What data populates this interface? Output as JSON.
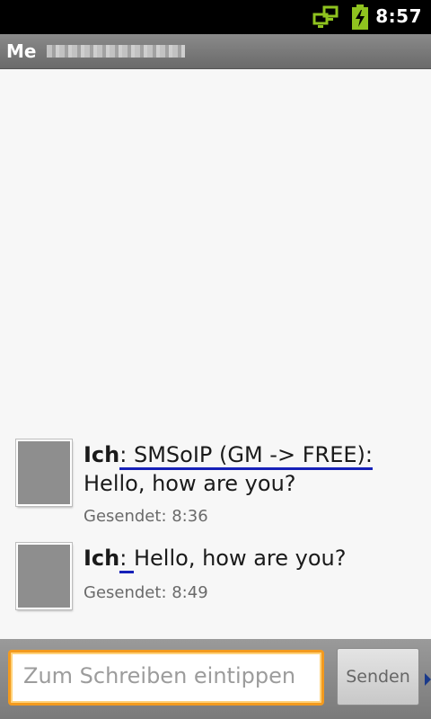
{
  "status_bar": {
    "time": "8:57",
    "icons": [
      "network-sync-icon",
      "battery-charging-icon"
    ]
  },
  "header": {
    "contact_label": "Me"
  },
  "messages": [
    {
      "sender": "Ich",
      "separator": ":",
      "link_text": " SMSoIP (GM -> FREE):",
      "text": "Hello, how are you?",
      "status": "Gesendet: 8:36"
    },
    {
      "sender": "Ich",
      "separator": ":",
      "link_text": " ",
      "text": "Hello, how are you?",
      "status": "Gesendet: 8:49"
    }
  ],
  "compose": {
    "placeholder": "Zum Schreiben eintippen",
    "send_label": "Senden"
  },
  "colors": {
    "accent": "#f39a1e",
    "link_underline": "#1620b8",
    "status_icon_green": "#8fc31f"
  }
}
